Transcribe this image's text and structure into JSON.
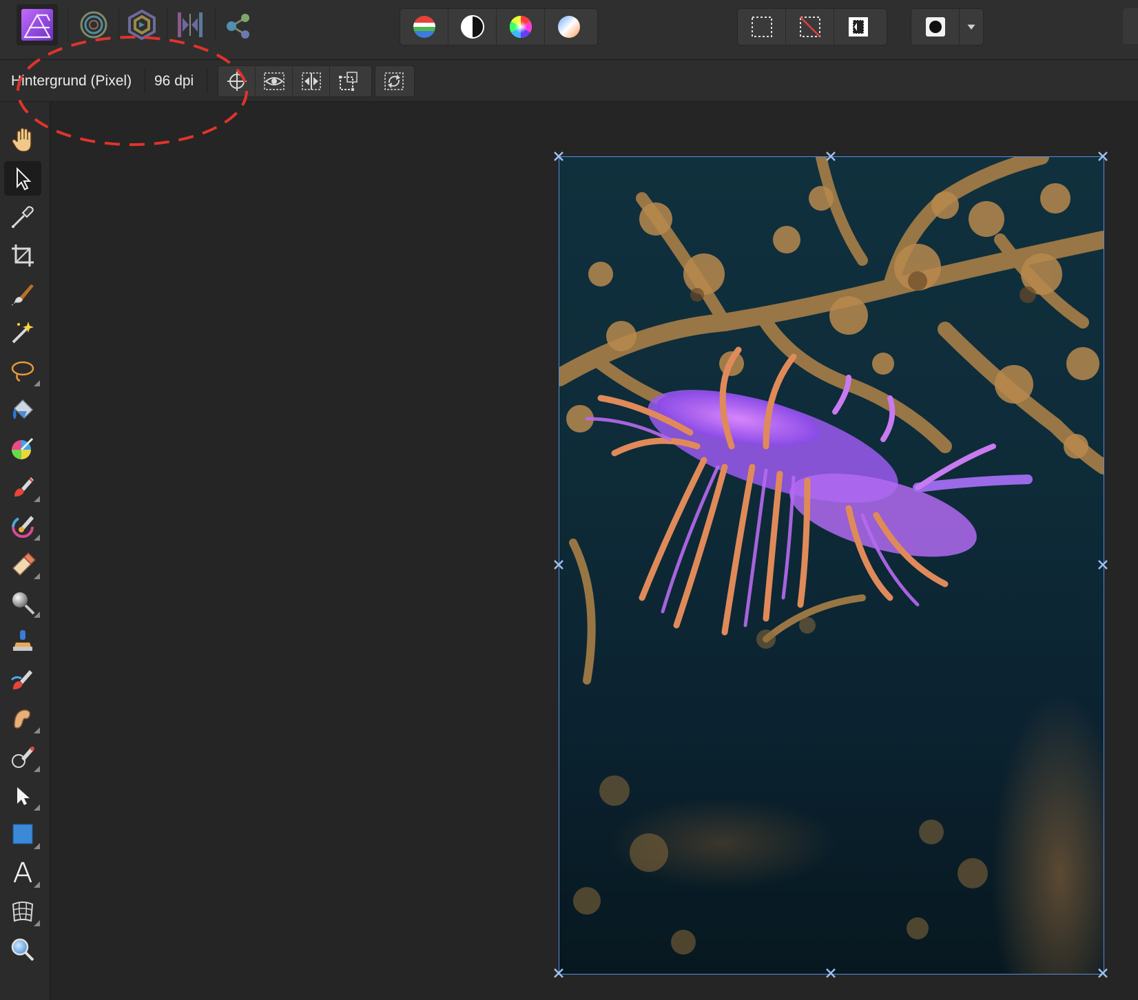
{
  "top_toolbar": {
    "personas": [
      {
        "icon": "photo-persona-icon",
        "active": true
      },
      {
        "icon": "liquify-persona-icon",
        "active": false
      },
      {
        "icon": "develop-persona-icon",
        "active": false
      },
      {
        "icon": "tone-mapping-persona-icon",
        "active": false
      },
      {
        "icon": "export-persona-icon",
        "active": false
      }
    ],
    "adjustment_buttons": [
      "levels-icon",
      "white-balance-icon",
      "hsl-icon",
      "recolor-icon"
    ],
    "selection_buttons": [
      "marquee-selection-icon",
      "deselect-icon",
      "invert-selection-icon"
    ],
    "mask_button": {
      "icon": "quick-mask-icon",
      "has_dropdown": true
    }
  },
  "context_toolbar": {
    "layer_label": "Hintergrund (Pixel)",
    "dpi_label": "96 dpi",
    "buttons": [
      "transform-origin-icon",
      "show-bounds-icon",
      "flip-icon",
      "transform-objects-icon",
      "rotate-icon"
    ]
  },
  "tools": [
    {
      "name": "view-tool",
      "icon": "hand-icon",
      "flyout": false,
      "active": false
    },
    {
      "name": "move-tool",
      "icon": "arrow-pointer-icon",
      "flyout": false,
      "active": true
    },
    {
      "name": "color-picker-tool",
      "icon": "eyedropper-icon",
      "flyout": false,
      "active": false
    },
    {
      "name": "crop-tool",
      "icon": "crop-icon",
      "flyout": false,
      "active": false
    },
    {
      "name": "selection-brush-tool",
      "icon": "selection-brush-icon",
      "flyout": false,
      "active": false
    },
    {
      "name": "flood-select-tool",
      "icon": "magic-wand-icon",
      "flyout": false,
      "active": false
    },
    {
      "name": "freehand-selection-tool",
      "icon": "lasso-icon",
      "flyout": true,
      "active": false
    },
    {
      "name": "flood-fill-tool",
      "icon": "paint-bucket-icon",
      "flyout": false,
      "active": false
    },
    {
      "name": "color-replacement-tool",
      "icon": "color-wheel-brush-icon",
      "flyout": false,
      "active": false
    },
    {
      "name": "paint-brush-tool",
      "icon": "paint-brush-icon",
      "flyout": true,
      "active": false
    },
    {
      "name": "mixer-brush-tool",
      "icon": "mixer-brush-icon",
      "flyout": true,
      "active": false
    },
    {
      "name": "erase-brush-tool",
      "icon": "eraser-icon",
      "flyout": true,
      "active": false
    },
    {
      "name": "dodge-tool",
      "icon": "dodge-icon",
      "flyout": true,
      "active": false
    },
    {
      "name": "clone-brush-tool",
      "icon": "clone-stamp-icon",
      "flyout": false,
      "active": false
    },
    {
      "name": "inpainting-brush-tool",
      "icon": "inpainting-brush-icon",
      "flyout": false,
      "active": false
    },
    {
      "name": "smudge-brush-tool",
      "icon": "smudge-icon",
      "flyout": true,
      "active": false
    },
    {
      "name": "red-eye-tool",
      "icon": "red-eye-brush-icon",
      "flyout": true,
      "active": false
    },
    {
      "name": "node-tool",
      "icon": "node-arrow-icon",
      "flyout": true,
      "active": false
    },
    {
      "name": "rectangle-tool",
      "icon": "rectangle-icon",
      "flyout": true,
      "active": false
    },
    {
      "name": "text-tool",
      "icon": "text-a-icon",
      "flyout": true,
      "active": false
    },
    {
      "name": "mesh-warp-tool",
      "icon": "mesh-warp-icon",
      "flyout": true,
      "active": false
    },
    {
      "name": "zoom-tool",
      "icon": "magnifier-icon",
      "flyout": false,
      "active": false
    }
  ],
  "document": {
    "subject": "violet nudibranch photo",
    "selection_color": "#5a8fdd"
  },
  "annotation": {
    "color": "#e0342b",
    "style": "dashed-ellipse"
  }
}
